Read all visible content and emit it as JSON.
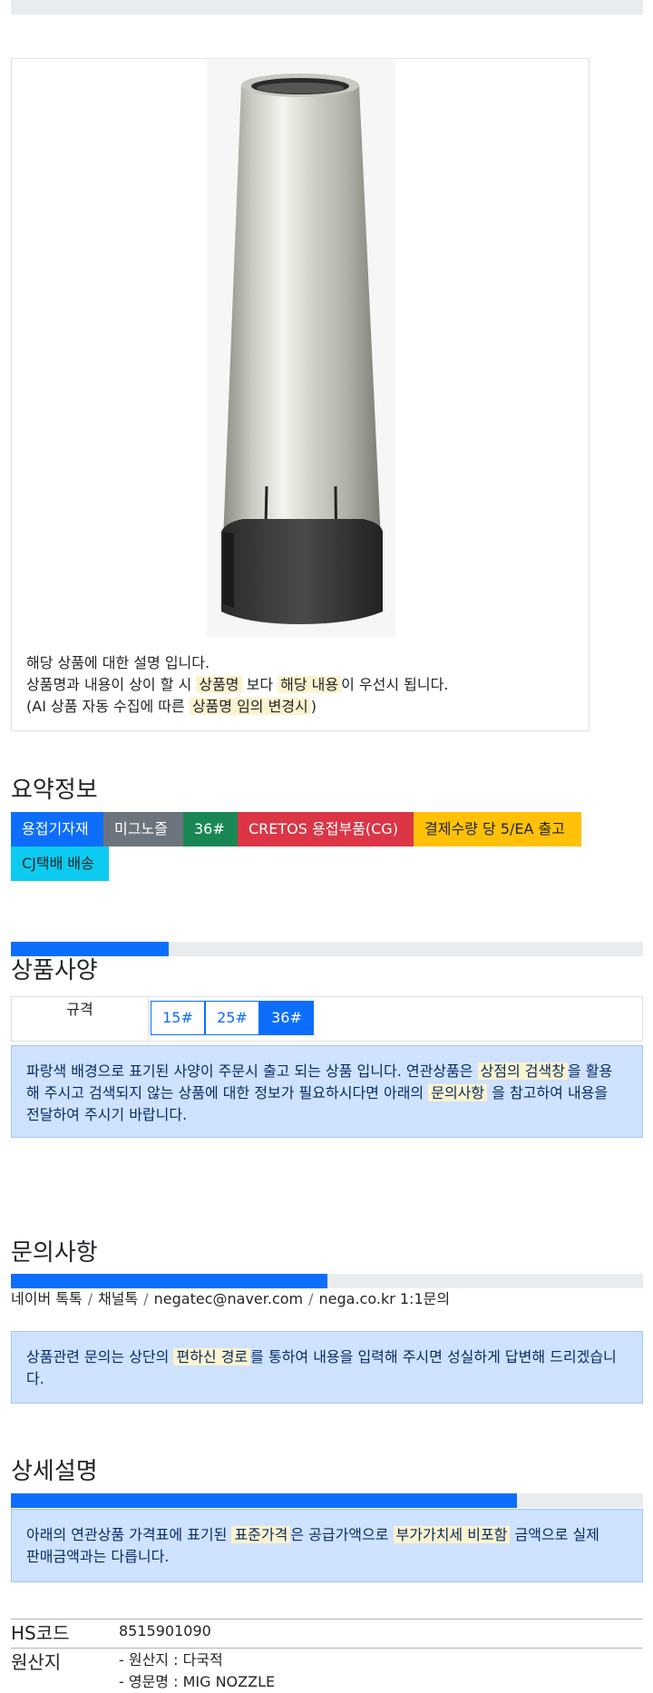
{
  "description": {
    "line1": "해당 상품에 대한 설명 입니다.",
    "line2_pre": "상품명과 내용이 상이 할 시 ",
    "line2_mark1": "상품명",
    "line2_mid": " 보다 ",
    "line2_mark2": "해당 내용",
    "line2_post": "이 우선시 됩니다.",
    "line3_pre": "(AI 상품 자동 수집에 따른 ",
    "line3_mark": "상품명 임의 변경시",
    "line3_post": ")"
  },
  "summary": {
    "title": "요약정보",
    "badges": [
      {
        "label": "용접기자재",
        "color": "#0d6efd"
      },
      {
        "label": "미그노즐",
        "color": "#6c757d"
      },
      {
        "label": "36#",
        "color": "#198754"
      },
      {
        "label": "CRETOS 용접부품(CG)",
        "color": "#dc3545"
      },
      {
        "label": "결제수량 당 5/EA 출고",
        "color": "#ffc107"
      },
      {
        "label": "CJ택배 배송",
        "color": "#0dcaf0"
      }
    ]
  },
  "spec": {
    "title": "상품사양",
    "progress": 0.25,
    "label": "규격",
    "options": [
      "15#",
      "25#",
      "36#"
    ],
    "selected": "36#",
    "alert_pre": "파랑색 배경으로 표기된 사양이 주문시 출고 되는 상품 입니다. 연관상품은 ",
    "alert_mark1": "상점의 검색창",
    "alert_mid1": "을 활용",
    "alert_line2_pre": "해 주시고 검색되지 않는 상품에 대한 정보가 필요하시다면 아래의 ",
    "alert_mark2": "문의사항",
    "alert_mid2": " 을 참고하여 내용을",
    "alert_line3": "전달하여 주시기 바랍니다."
  },
  "inquiry": {
    "title": "문의사항",
    "progress": 0.5,
    "crumbs": [
      "네이버 톡톡",
      "채널톡",
      "negatec@naver.com",
      "nega.co.kr 1:1문의"
    ],
    "alert_pre": "상품관련 문의는 상단의 ",
    "alert_mark": "편하신 경로",
    "alert_post": "를 통하여 내용을 입력해 주시면 성실하게 답변해 드리겠습니",
    "alert_line2": "다."
  },
  "detail": {
    "title": "상세설명",
    "progress": 0.8,
    "alert_pre": "아래의 연관상품 가격표에 표기된 ",
    "alert_mark1": "표준가격",
    "alert_mid": "은 공급가액으로 ",
    "alert_mark2": "부가가치세 비포함",
    "alert_post": " 금액으로 실제",
    "alert_line2": "판매금액과는 다릅니다."
  },
  "info": {
    "hs_key": "HS코드",
    "hs_value": "8515901090",
    "origin_key": "원산지",
    "origin_line1": "- 원산지 : 다국적",
    "origin_line2": "- 영문명 : MIG NOZZLE"
  }
}
